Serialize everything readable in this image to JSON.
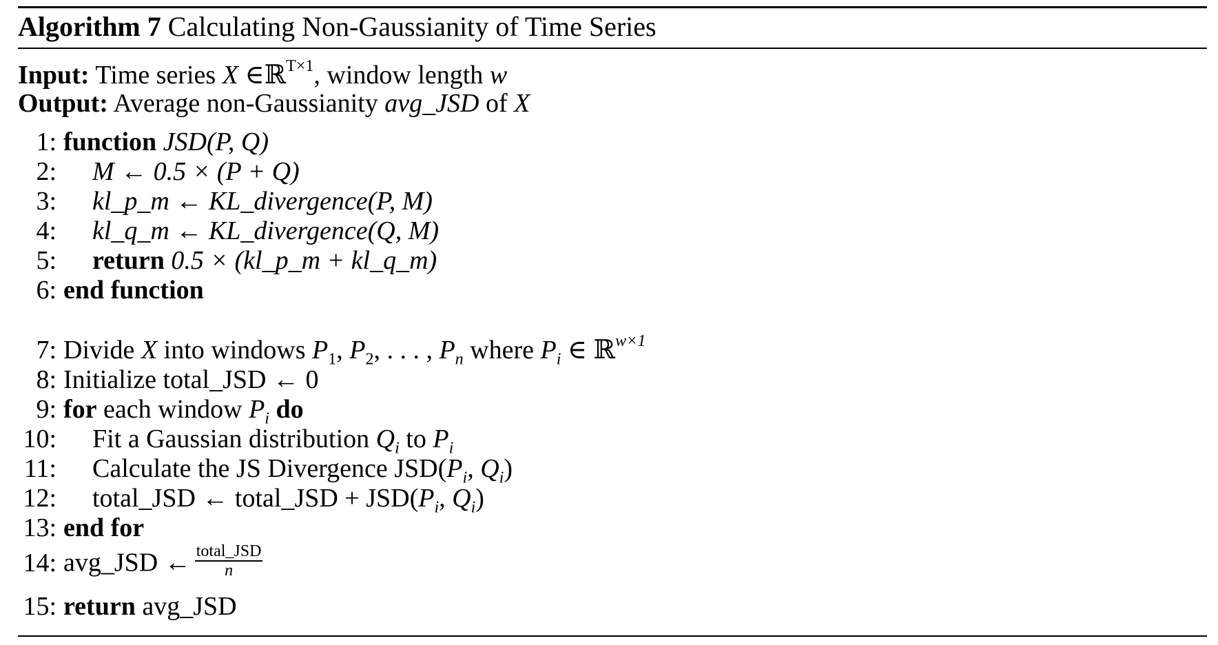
{
  "algorithm": {
    "label": "Algorithm 7",
    "title": "Calculating Non-Gaussianity of Time Series"
  },
  "input": {
    "keyword": "Input:",
    "text_1": "Time series",
    "var": "X",
    "in_sym": "∈",
    "space": "ℝ",
    "space_sup": "T×1",
    "text_2": ", window length",
    "param": "w"
  },
  "output": {
    "keyword": "Output:",
    "text_1": "Average non-Gaussianity",
    "var": "avg_JSD",
    "text_2": "of",
    "var2": "X"
  },
  "lines": {
    "l1": {
      "num": "1:",
      "kw": "function",
      "expr": "JSD(P, Q)"
    },
    "l2": {
      "num": "2:",
      "expr": "M ← 0.5 × (P + Q)"
    },
    "l3": {
      "num": "3:",
      "expr": "kl_p_m ← KL_divergence(P, M)"
    },
    "l4": {
      "num": "4:",
      "expr": "kl_q_m ← KL_divergence(Q, M)"
    },
    "l5": {
      "num": "5:",
      "kw": "return",
      "expr": "0.5 × (kl_p_m + kl_q_m)"
    },
    "l6": {
      "num": "6:",
      "kw": "end function"
    },
    "l7": {
      "num": "7:",
      "text_1": "Divide",
      "var": "X",
      "text_2": "into windows",
      "expr": "P",
      "sub1": "1",
      "sub2": "2",
      "subn": "n",
      "text_3": "where",
      "pi": "P",
      "pi_sub": "i",
      "space": "ℝ",
      "space_sup": "w×1"
    },
    "l8": {
      "num": "8:",
      "text": "Initialize total_JSD ← 0"
    },
    "l9": {
      "num": "9:",
      "kw": "for",
      "text": "each window",
      "var": "P",
      "var_sub": "i",
      "kw2": "do"
    },
    "l10": {
      "num": "10:",
      "text_1": "Fit a Gaussian distribution",
      "var1": "Q",
      "var1_sub": "i",
      "text_2": "to",
      "var2": "P",
      "var2_sub": "i"
    },
    "l11": {
      "num": "11:",
      "text": "Calculate the JS Divergence JSD"
    },
    "l12": {
      "num": "12:",
      "text": "total_JSD ← total_JSD + JSD"
    },
    "l13": {
      "num": "13:",
      "kw": "end for"
    },
    "l14": {
      "num": "14:",
      "text": "avg_JSD ←",
      "frac_num": "total_JSD",
      "frac_den": "n"
    },
    "l15": {
      "num": "15:",
      "kw": "return",
      "text": "avg_JSD"
    }
  }
}
